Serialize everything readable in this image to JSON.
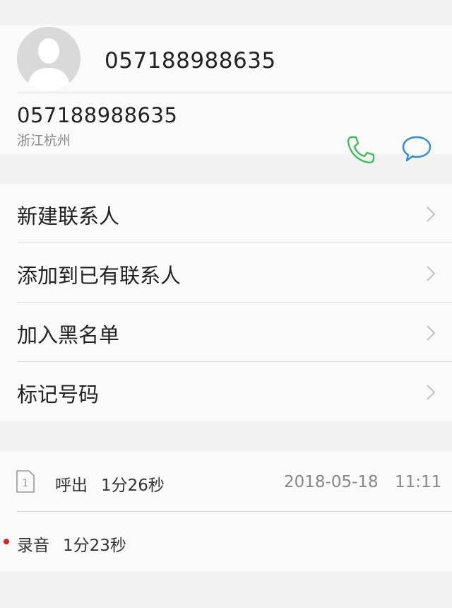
{
  "header": {
    "contact_title": "057188988635",
    "phone_number": "057188988635",
    "location": "浙江杭州",
    "call_icon": "phone-icon",
    "message_icon": "message-bubble-icon",
    "avatar_icon": "person-silhouette-icon"
  },
  "menu": {
    "items": [
      {
        "label": "新建联系人"
      },
      {
        "label": "添加到已有联系人"
      },
      {
        "label": "加入黑名单"
      },
      {
        "label": "标记号码"
      }
    ]
  },
  "call_log": {
    "sim_slot": "1",
    "direction": "呼出",
    "duration": "1分26秒",
    "date": "2018-05-18",
    "time": "11:11",
    "recording_label": "录音",
    "recording_duration": "1分23秒"
  },
  "colors": {
    "call_green": "#3cbf55",
    "message_blue": "#2a8fd8",
    "recording_red": "#e02020",
    "background": "#f2f2f2",
    "card": "#fafafa"
  }
}
